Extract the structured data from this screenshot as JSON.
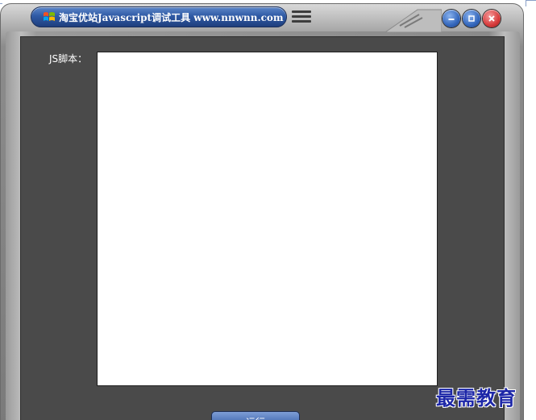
{
  "window": {
    "title": "淘宝优站Javascript调试工具 www.nnwnn.com"
  },
  "editor": {
    "label": "JS脚本：",
    "value": ""
  },
  "actions": {
    "run_label": "运行"
  },
  "watermark": {
    "text": "最需教育"
  },
  "icons": {
    "logo": "windows-logo-icon",
    "menu": "menu-icon",
    "minimize": "minimize-icon",
    "maximize": "maximize-icon",
    "close": "close-icon"
  },
  "colors": {
    "title_bar": "#2f5aa5",
    "panel": "#4a4a4a",
    "close": "#d63a3a",
    "watermark": "#1d27a8"
  }
}
